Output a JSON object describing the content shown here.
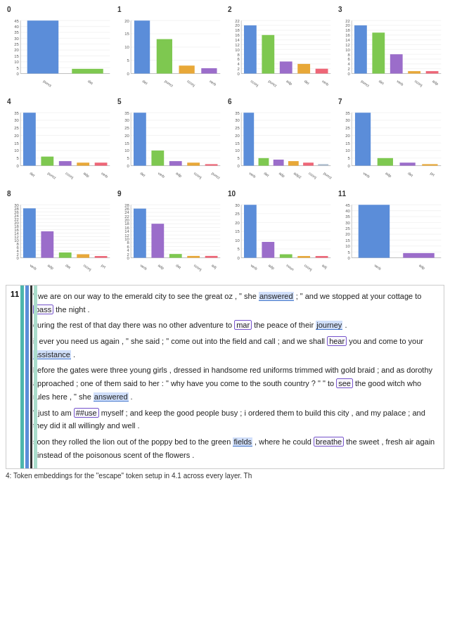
{
  "charts": [
    {
      "index": "0",
      "labels": [
        "punct",
        "det"
      ],
      "bars": [
        {
          "label": "punct",
          "value": 45,
          "color": "#5b8dd9"
        },
        {
          "label": "det",
          "value": 4,
          "color": "#7ec850"
        }
      ],
      "ymax": 45,
      "yticks": [
        0,
        5,
        10,
        15,
        20,
        25,
        30,
        35,
        40,
        45
      ]
    },
    {
      "index": "1",
      "labels": [
        "det",
        "punct",
        "cconj",
        "verb"
      ],
      "bars": [
        {
          "label": "det",
          "value": 20,
          "color": "#5b8dd9"
        },
        {
          "label": "punct",
          "value": 13,
          "color": "#7ec850"
        },
        {
          "label": "cconj",
          "value": 3,
          "color": "#e8a838"
        },
        {
          "label": "verb",
          "value": 2,
          "color": "#9b6dca"
        }
      ],
      "ymax": 20,
      "yticks": [
        0,
        5,
        10,
        15,
        20
      ]
    },
    {
      "index": "2",
      "labels": [
        "cconj",
        "punct",
        "adp",
        "det",
        "verb"
      ],
      "bars": [
        {
          "label": "cconj",
          "value": 20,
          "color": "#5b8dd9"
        },
        {
          "label": "punct",
          "value": 16,
          "color": "#7ec850"
        },
        {
          "label": "adp",
          "value": 5,
          "color": "#9b6dca"
        },
        {
          "label": "det",
          "value": 4,
          "color": "#e8a838"
        },
        {
          "label": "verb",
          "value": 2,
          "color": "#ee6677"
        }
      ],
      "ymax": 22,
      "yticks": [
        0,
        2,
        4,
        6,
        8,
        10,
        12,
        14,
        16,
        18,
        20,
        22
      ]
    },
    {
      "index": "3",
      "labels": [
        "punct",
        "det",
        "verb",
        "cconj",
        "adp"
      ],
      "bars": [
        {
          "label": "punct",
          "value": 20,
          "color": "#5b8dd9"
        },
        {
          "label": "det",
          "value": 17,
          "color": "#7ec850"
        },
        {
          "label": "verb",
          "value": 8,
          "color": "#9b6dca"
        },
        {
          "label": "cconj",
          "value": 1,
          "color": "#e8a838"
        },
        {
          "label": "adp",
          "value": 1,
          "color": "#ee6677"
        }
      ],
      "ymax": 22,
      "yticks": [
        0,
        2,
        4,
        6,
        8,
        10,
        12,
        14,
        16,
        18,
        20,
        22
      ]
    },
    {
      "index": "4",
      "labels": [
        "det",
        "punct",
        "cconj",
        "adp",
        "verb"
      ],
      "bars": [
        {
          "label": "det",
          "value": 35,
          "color": "#5b8dd9"
        },
        {
          "label": "punct",
          "value": 6,
          "color": "#7ec850"
        },
        {
          "label": "cconj",
          "value": 3,
          "color": "#9b6dca"
        },
        {
          "label": "adp",
          "value": 2,
          "color": "#e8a838"
        },
        {
          "label": "verb",
          "value": 2,
          "color": "#ee6677"
        }
      ],
      "ymax": 35,
      "yticks": [
        0,
        5,
        10,
        15,
        20,
        25,
        30,
        35
      ]
    },
    {
      "index": "5",
      "labels": [
        "det",
        "verb",
        "adp",
        "cconj",
        "punct"
      ],
      "bars": [
        {
          "label": "det",
          "value": 35,
          "color": "#5b8dd9"
        },
        {
          "label": "verb",
          "value": 10,
          "color": "#7ec850"
        },
        {
          "label": "adp",
          "value": 3,
          "color": "#9b6dca"
        },
        {
          "label": "cconj",
          "value": 2,
          "color": "#e8a838"
        },
        {
          "label": "punct",
          "value": 1,
          "color": "#ee6677"
        }
      ],
      "ymax": 35,
      "yticks": [
        0,
        5,
        10,
        15,
        20,
        25,
        30,
        35
      ]
    },
    {
      "index": "6",
      "labels": [
        "verb",
        "det",
        "adp",
        "adp",
        "cconj",
        "punct"
      ],
      "bars": [
        {
          "label": "verb",
          "value": 35,
          "color": "#5b8dd9"
        },
        {
          "label": "det",
          "value": 5,
          "color": "#7ec850"
        },
        {
          "label": "adp",
          "value": 4,
          "color": "#9b6dca"
        },
        {
          "label": "adp2",
          "value": 3,
          "color": "#e8a838"
        },
        {
          "label": "cconj",
          "value": 2,
          "color": "#ee6677"
        },
        {
          "label": "punct",
          "value": 1,
          "color": "#aabbcc"
        }
      ],
      "ymax": 35,
      "yticks": [
        0,
        5,
        10,
        15,
        20,
        25,
        30,
        35
      ]
    },
    {
      "index": "7",
      "labels": [
        "verb",
        "adp",
        "det",
        "prt"
      ],
      "bars": [
        {
          "label": "verb",
          "value": 35,
          "color": "#5b8dd9"
        },
        {
          "label": "adp",
          "value": 5,
          "color": "#7ec850"
        },
        {
          "label": "det",
          "value": 2,
          "color": "#9b6dca"
        },
        {
          "label": "prt",
          "value": 1,
          "color": "#e8a838"
        }
      ],
      "ymax": 35,
      "yticks": [
        0,
        5,
        10,
        15,
        20,
        25,
        30,
        35
      ]
    },
    {
      "index": "8",
      "labels": [
        "verb",
        "adp",
        "det",
        "cconj",
        "prt"
      ],
      "bars": [
        {
          "label": "verb",
          "value": 28,
          "color": "#5b8dd9"
        },
        {
          "label": "adp",
          "value": 15,
          "color": "#9b6dca"
        },
        {
          "label": "det",
          "value": 3,
          "color": "#7ec850"
        },
        {
          "label": "cconj",
          "value": 2,
          "color": "#e8a838"
        },
        {
          "label": "prt",
          "value": 1,
          "color": "#ee6677"
        }
      ],
      "ymax": 30,
      "yticks": [
        0,
        2,
        4,
        6,
        8,
        10,
        12,
        14,
        16,
        18,
        20,
        22,
        24,
        26,
        28,
        30
      ]
    },
    {
      "index": "9",
      "labels": [
        "verb",
        "adp",
        "det",
        "cconj",
        "adj"
      ],
      "bars": [
        {
          "label": "verb",
          "value": 26,
          "color": "#5b8dd9"
        },
        {
          "label": "adp",
          "value": 18,
          "color": "#9b6dca"
        },
        {
          "label": "det",
          "value": 2,
          "color": "#7ec850"
        },
        {
          "label": "cconj",
          "value": 1,
          "color": "#e8a838"
        },
        {
          "label": "adj",
          "value": 1,
          "color": "#ee6677"
        }
      ],
      "ymax": 28,
      "yticks": [
        0,
        2,
        4,
        6,
        8,
        10,
        12,
        14,
        16,
        18,
        20,
        22,
        24,
        26,
        28
      ]
    },
    {
      "index": "10",
      "labels": [
        "verb",
        "adp",
        "noun",
        "cconj",
        "adj"
      ],
      "bars": [
        {
          "label": "verb",
          "value": 30,
          "color": "#5b8dd9"
        },
        {
          "label": "adp",
          "value": 9,
          "color": "#9b6dca"
        },
        {
          "label": "noun",
          "value": 2,
          "color": "#7ec850"
        },
        {
          "label": "cconj",
          "value": 1,
          "color": "#e8a838"
        },
        {
          "label": "adj",
          "value": 1,
          "color": "#ee6677"
        }
      ],
      "ymax": 30,
      "yticks": [
        0,
        5,
        10,
        15,
        20,
        25,
        30
      ]
    },
    {
      "index": "11",
      "labels": [
        "verb",
        "adp"
      ],
      "bars": [
        {
          "label": "verb",
          "value": 45,
          "color": "#5b8dd9"
        },
        {
          "label": "adp",
          "value": 4,
          "color": "#9b6dca"
        }
      ],
      "ymax": 45,
      "yticks": [
        0,
        5,
        10,
        15,
        20,
        25,
        30,
        35,
        40,
        45
      ]
    }
  ],
  "text_panel": {
    "index": "11",
    "sentences": [
      {
        "id": "s1",
        "text": "\" we are on our way to the emerald city to see the great oz , \" she answered ; \" and we stopped at your cottage to pass the night .",
        "highlights": [
          {
            "word": "pass",
            "type": "box"
          },
          {
            "word": "answered",
            "type": "blue"
          }
        ]
      },
      {
        "id": "s2",
        "text": "during the rest of that day there was no other adventure to mar the peace of their journey .",
        "highlights": [
          {
            "word": "mar",
            "type": "box"
          },
          {
            "word": "journey",
            "type": "blue"
          }
        ]
      },
      {
        "id": "s3",
        "text": "if ever you need us again , \" she said ; \" come out into the field and call ; and we shall hear you and come to your assistance .",
        "highlights": [
          {
            "word": "hear",
            "type": "box"
          },
          {
            "word": "assistance",
            "type": "blue"
          }
        ]
      },
      {
        "id": "s4",
        "text": "before the gates were three young girls , dressed in handsome red uniforms trimmed with gold braid ; and as dorothy approached ; one of them said to her : \" why have you come to the south country ? \" \" to see the good witch who rules here , \" she answered .",
        "highlights": [
          {
            "word": "see",
            "type": "box"
          },
          {
            "word": "answered",
            "type": "blue"
          }
        ]
      },
      {
        "id": "s5",
        "text": "\" just to am ##use myself ; and keep the good people busy ; i ordered them to build this city , and my palace ; and they did it all willingly and well .",
        "highlights": [
          {
            "word": "##use",
            "type": "box"
          }
        ]
      },
      {
        "id": "s6",
        "text": "soon they rolled the lion out of the poppy bed to the green fields , where he could breathe the sweet , fresh air again , instead of the poisonous scent of the flowers .",
        "highlights": [
          {
            "word": "breathe",
            "type": "box"
          },
          {
            "word": "fields",
            "type": "blue"
          }
        ]
      }
    ]
  },
  "caption": "4: Token embeddings for the \"escape\" token setup in 4.1 across every layer. Th"
}
